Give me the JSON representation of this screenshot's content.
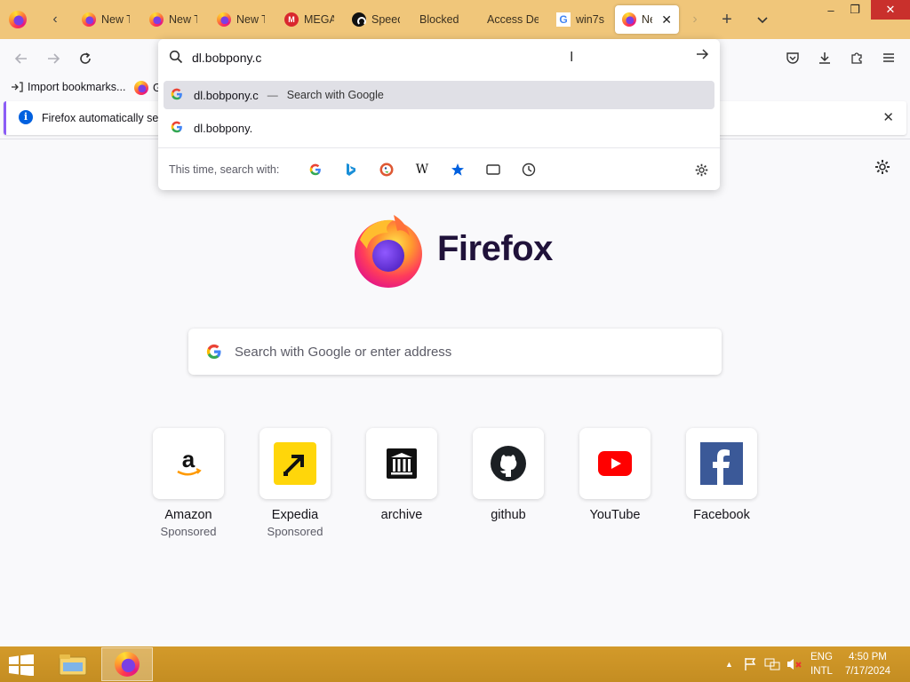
{
  "tabs": [
    {
      "label": "New T",
      "favicon": "firefox-icon",
      "active": false
    },
    {
      "label": "New T",
      "favicon": "firefox-icon",
      "active": false
    },
    {
      "label": "New T",
      "favicon": "firefox-icon",
      "active": false
    },
    {
      "label": "MEGA",
      "favicon": "mega-icon",
      "active": false
    },
    {
      "label": "Speed",
      "favicon": "speedtest-icon",
      "active": false
    },
    {
      "label": "Blocked",
      "favicon": "none",
      "active": false
    },
    {
      "label": "Access De",
      "favicon": "none",
      "active": false
    },
    {
      "label": "win7s",
      "favicon": "google-icon",
      "active": false
    },
    {
      "label": "Ne",
      "favicon": "firefox-icon",
      "active": true
    }
  ],
  "window_controls": {
    "minimize": "–",
    "restore": "❐",
    "close": "✕"
  },
  "urlbar": {
    "value": "dl.bobpony.c",
    "suggestions": [
      {
        "text": "dl.bobpony.c",
        "separator": "—",
        "action": "Search with Google",
        "selected": true
      },
      {
        "text": "dl.bobpony.",
        "separator": "",
        "action": "",
        "selected": false
      }
    ],
    "one_off_label": "This time, search with:",
    "engines": [
      "google-icon",
      "bing-icon",
      "duckduckgo-icon",
      "wikipedia-icon",
      "bookmarks-icon",
      "tabs-icon",
      "history-icon"
    ]
  },
  "bookmarks": {
    "import_label": "Import bookmarks...",
    "second_label": "G"
  },
  "notification": {
    "text": "Firefox automatically sends some data to Mozilla"
  },
  "newtab": {
    "wordmark": "Firefox",
    "search_placeholder": "Search with Google or enter address",
    "shortcuts": [
      {
        "name": "Amazon",
        "sponsored": "Sponsored",
        "icon": "amazon-icon"
      },
      {
        "name": "Expedia",
        "sponsored": "Sponsored",
        "icon": "expedia-icon"
      },
      {
        "name": "archive",
        "sponsored": "",
        "icon": "archive-icon"
      },
      {
        "name": "github",
        "sponsored": "",
        "icon": "github-icon"
      },
      {
        "name": "YouTube",
        "sponsored": "",
        "icon": "youtube-icon"
      },
      {
        "name": "Facebook",
        "sponsored": "",
        "icon": "facebook-icon"
      }
    ]
  },
  "taskbar": {
    "lang_top": "ENG",
    "lang_bottom": "INTL",
    "time": "4:50 PM",
    "date": "7/17/2024"
  },
  "colors": {
    "tabstrip": "#f0c67a",
    "taskbar": "#c48d22",
    "accent": "#0060df"
  }
}
